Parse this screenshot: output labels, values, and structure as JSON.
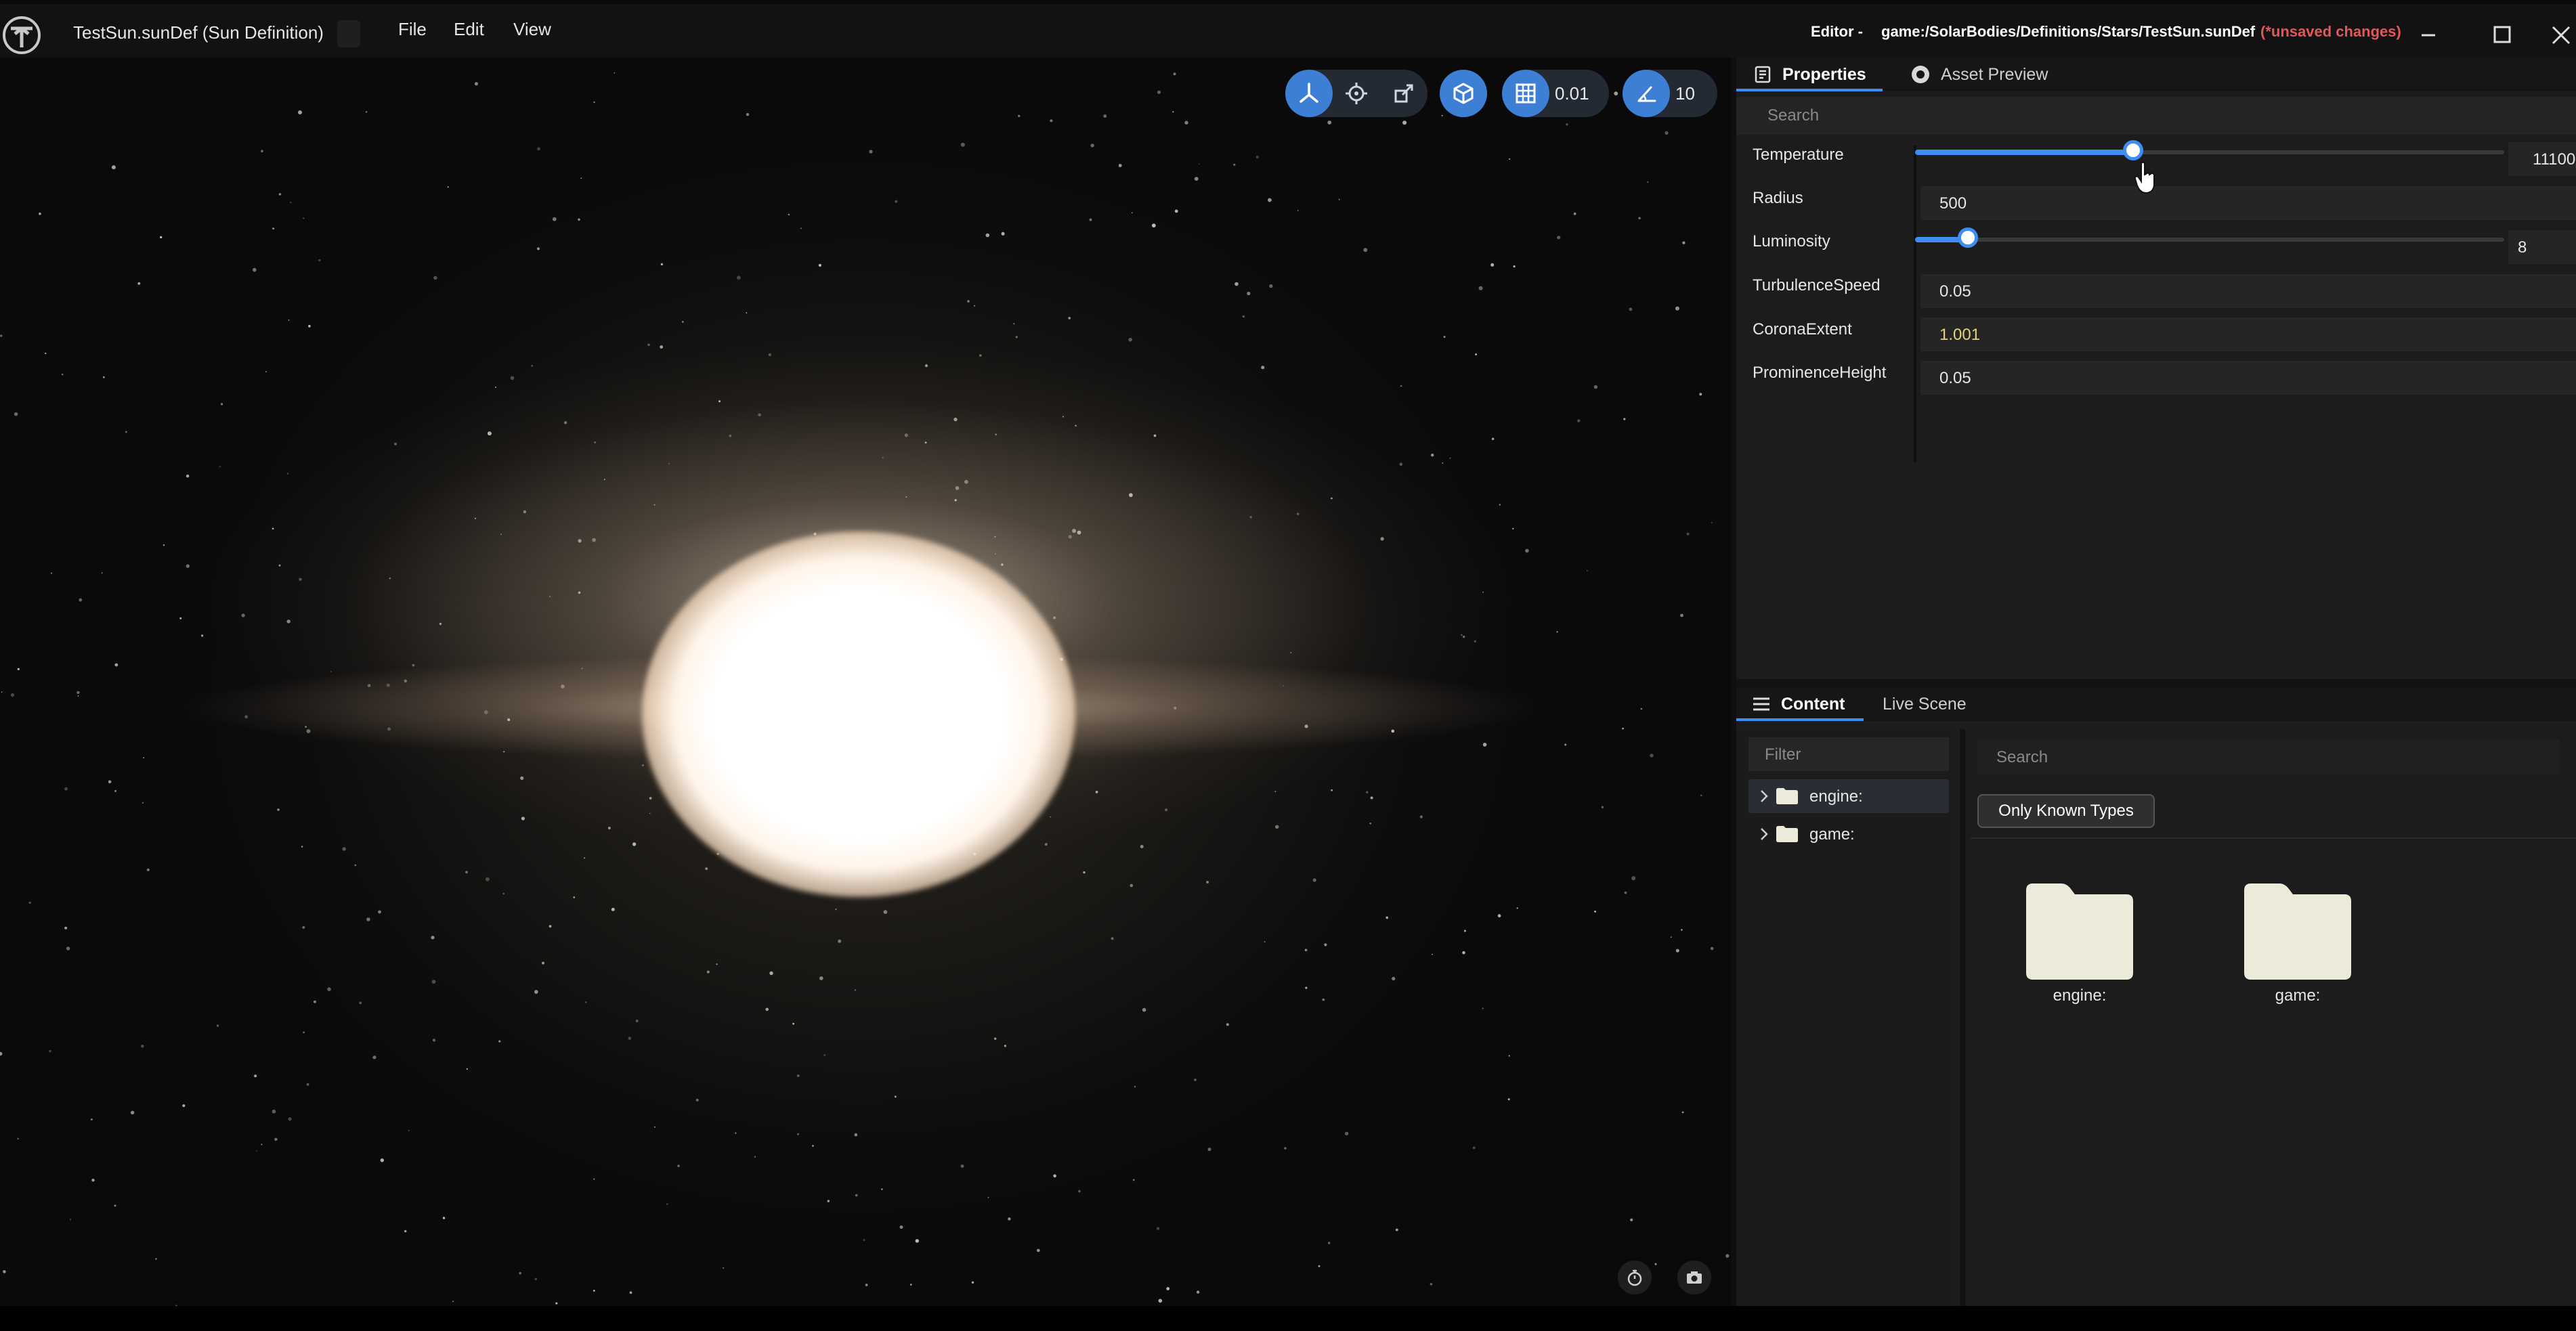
{
  "window": {
    "title": "TestSun.sunDef (Sun Definition)",
    "menus": [
      "File",
      "Edit",
      "View"
    ],
    "editor_label": "Editor -",
    "path": "game:/SolarBodies/Definitions/Stars/TestSun.sunDef",
    "unsaved": "(*unsaved changes)",
    "icons": {
      "logo": "editor-logo-icon",
      "minimize": "minimize-icon",
      "maximize": "maximize-icon",
      "close": "close-icon"
    }
  },
  "viewport": {
    "toolbar": {
      "transform_tools": [
        "translate-icon",
        "rotate-icon",
        "scale-icon"
      ],
      "local_space_icon": "cube-icon",
      "snap_grid_icon": "grid-icon",
      "snap_grid_value": "0.01",
      "snap_angle_icon": "angle-icon",
      "snap_angle_value": "10"
    },
    "bottom_icons": [
      "stopwatch-icon",
      "camera-icon"
    ]
  },
  "properties_panel": {
    "tabs": [
      {
        "label": "Properties",
        "icon": "properties-icon",
        "active": true
      },
      {
        "label": "Asset Preview",
        "icon": "eye-icon",
        "active": false
      }
    ],
    "search_placeholder": "Search",
    "properties": [
      {
        "label": "Temperature",
        "type": "slider",
        "value": "11100",
        "fraction": 0.37
      },
      {
        "label": "Radius",
        "type": "number",
        "value": "500"
      },
      {
        "label": "Luminosity",
        "type": "slider",
        "value": "8",
        "fraction": 0.09
      },
      {
        "label": "TurbulenceSpeed",
        "type": "number",
        "value": "0.05"
      },
      {
        "label": "CoronaExtent",
        "type": "number",
        "value": "1.001"
      },
      {
        "label": "ProminenceHeight",
        "type": "number",
        "value": "0.05"
      }
    ]
  },
  "content_panel": {
    "tabs": [
      {
        "label": "Content",
        "icon": "list-icon",
        "active": true
      },
      {
        "label": "Live Scene",
        "active": false
      }
    ],
    "filter_placeholder": "Filter",
    "tree": [
      {
        "label": "engine:",
        "icon": "folder-icon",
        "selected": true
      },
      {
        "label": "game:",
        "icon": "folder-icon",
        "selected": false
      }
    ],
    "search_placeholder": "Search",
    "only_known_types": "Only Known Types",
    "items": [
      {
        "label": "engine:",
        "icon": "folder-icon"
      },
      {
        "label": "game:",
        "icon": "folder-icon"
      }
    ]
  },
  "colors": {
    "accent": "#3d8ef0",
    "unsaved": "#e35858",
    "folder": "#ecead8"
  }
}
